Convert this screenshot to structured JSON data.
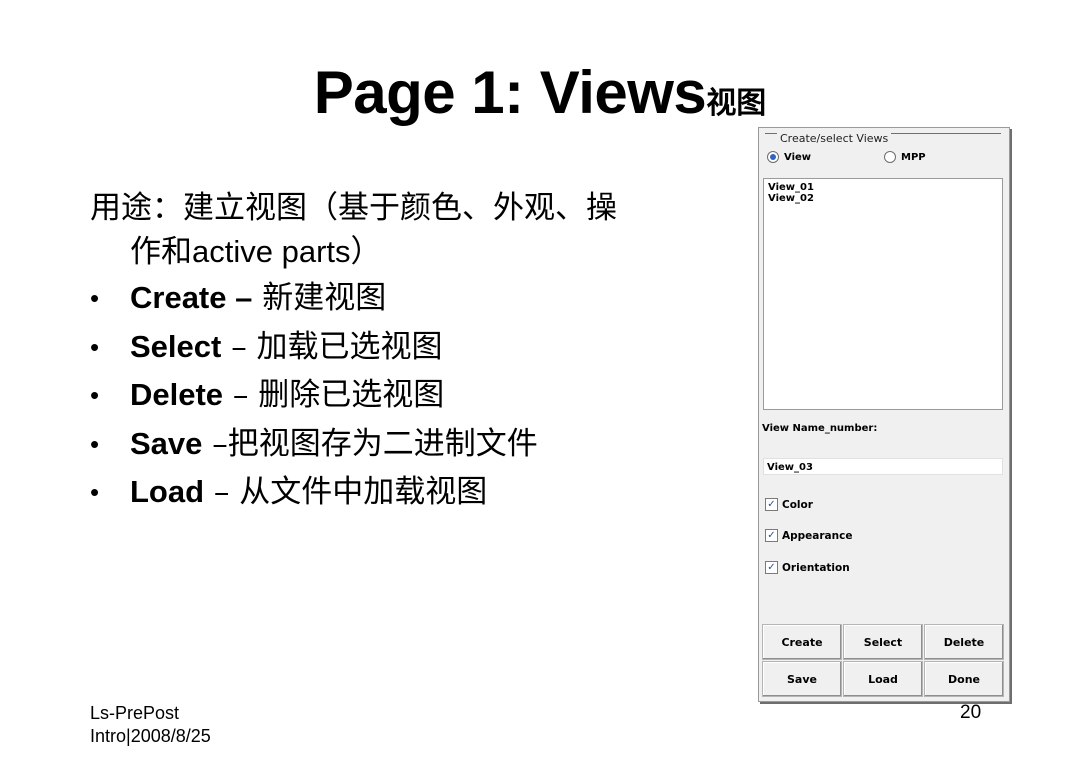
{
  "slide": {
    "title": "Page 1: Views",
    "title_sub": "视图",
    "purpose_line1": "用途：建立视图（基于颜色、外观、操",
    "purpose_line2_prefix": "作和",
    "purpose_line2_latin": "active parts",
    "purpose_line2_suffix": "）",
    "bullet_char": "•",
    "bullets": [
      {
        "bold": "Create –",
        "rest": " 新建视图"
      },
      {
        "bold": "Select",
        "rest": " – 加载已选视图"
      },
      {
        "bold": "Delete",
        "rest": " – 删除已选视图"
      },
      {
        "bold": "Save",
        "rest": " –把视图存为二进制文件"
      },
      {
        "bold": "Load",
        "rest": " – 从文件中加载视图"
      }
    ],
    "footer_line1": "Ls-PrePost",
    "footer_line2": "Intro|2008/8/25",
    "page_number": "20"
  },
  "dialog": {
    "group_title": "Create/select Views",
    "radio_view": "View",
    "radio_mpp": "MPP",
    "radio_selected": "View",
    "list_items": [
      "View_01",
      "View_02"
    ],
    "name_label": "View Name_number:",
    "name_value": "View_03",
    "checks": [
      {
        "label": "Color",
        "checked": true
      },
      {
        "label": "Appearance",
        "checked": true
      },
      {
        "label": "Orientation",
        "checked": true
      }
    ],
    "check_mark": "✓",
    "buttons": {
      "create": "Create",
      "select": "Select",
      "delete": "Delete",
      "save": "Save",
      "load": "Load",
      "done": "Done"
    },
    "accent_color": "#3561c2"
  }
}
